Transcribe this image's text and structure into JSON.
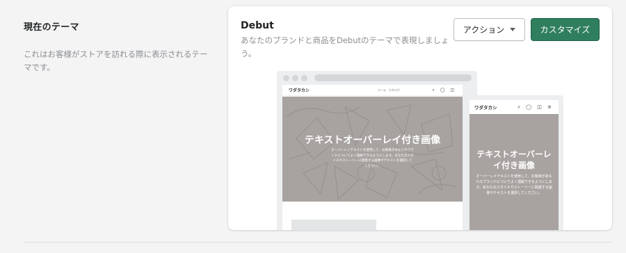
{
  "section": {
    "title": "現在のテーマ",
    "description": "これはお客様がストアを訪れる際に表示されるテーマです。"
  },
  "theme": {
    "name": "Debut",
    "description": "あなたのブランドと商品をDebutのテーマで表現しましょう。",
    "action_label": "アクション",
    "customize_label": "カスタマイズ",
    "accent_color": "#2f7f5e"
  },
  "preview": {
    "desktop": {
      "logo": "ワダタカシ",
      "nav_items": "ホーム　カタログ",
      "icons": "⌕ ◯ ◫",
      "hero_title": "テキストオーバーレイ付き画像",
      "hero_text": "オーバーレイテキストを使用して、お客様があなたのブランドについてよく理解できるようにします。あなたのスタイルやストーリーに関連する画像やテキストを選択してください。"
    },
    "mobile": {
      "logo": "ワダタカシ",
      "icons": "⌕ ◯ ◫ ≡",
      "hero_title": "テキストオーバーレイ付き画像",
      "hero_text": "オーバーレイテキストを使用して、お客様があなたのブランドについてよく理解できるようにします。あなたのスタイルやストーリーに関連する画像やテキストを選択してください。"
    },
    "hero_color": "#a8a3a0"
  }
}
